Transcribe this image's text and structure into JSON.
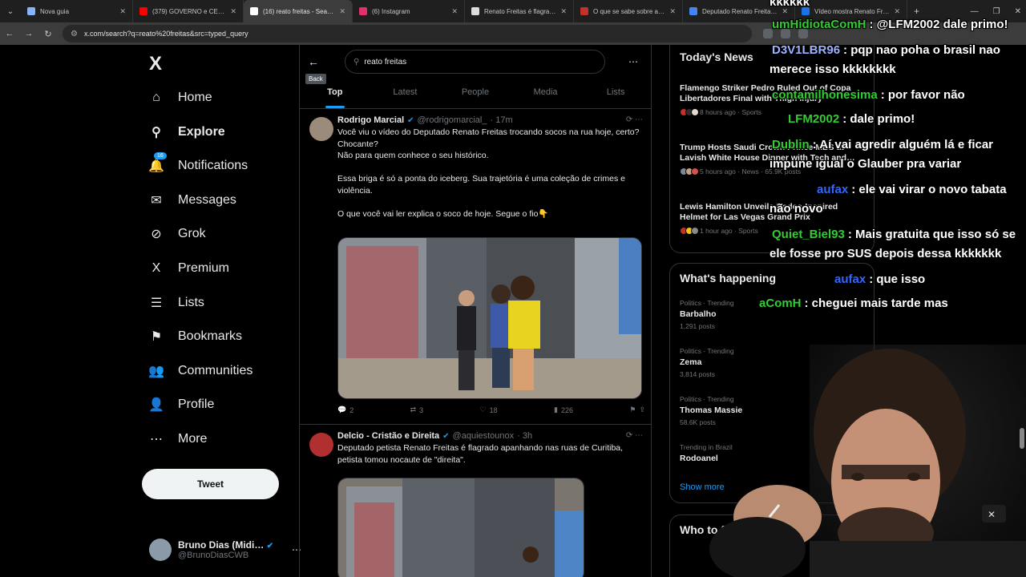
{
  "browser": {
    "tabs": [
      {
        "label": "Nova guia",
        "color": "#8ab4f8"
      },
      {
        "label": "(379) GOVERNO e CENTR…",
        "color": "#ff0000"
      },
      {
        "label": "(16) reato freitas - Search",
        "color": "#ffffff",
        "active": true
      },
      {
        "label": "(6) Instagram",
        "color": "#e1306c"
      },
      {
        "label": "Renato Freitas é flagrado…",
        "color": "#dddddd"
      },
      {
        "label": "O que se sabe sobre a bri…",
        "color": "#c4302b"
      },
      {
        "label": "Deputado Renato Freitas…",
        "color": "#4285f4"
      },
      {
        "label": "Vídeo mostra Renato Frei…",
        "color": "#1a73e8"
      }
    ],
    "new_tab": "+",
    "url": "x.com/search?q=reato%20freitas&src=typed_query"
  },
  "nav": {
    "logo": "X",
    "items": [
      {
        "label": "Home",
        "icon": "home-icon",
        "glyph": "⌂"
      },
      {
        "label": "Explore",
        "icon": "search-icon",
        "glyph": "⚲"
      },
      {
        "label": "Notifications",
        "icon": "bell-icon",
        "glyph": "🔔",
        "badge": "16"
      },
      {
        "label": "Messages",
        "icon": "mail-icon",
        "glyph": "✉"
      },
      {
        "label": "Grok",
        "icon": "grok-icon",
        "glyph": "⊘"
      },
      {
        "label": "Premium",
        "icon": "x-icon",
        "glyph": "X"
      },
      {
        "label": "Lists",
        "icon": "list-icon",
        "glyph": "☰"
      },
      {
        "label": "Bookmarks",
        "icon": "bookmark-icon",
        "glyph": "⚑"
      },
      {
        "label": "Communities",
        "icon": "people-icon",
        "glyph": "👥"
      },
      {
        "label": "Profile",
        "icon": "person-icon",
        "glyph": "👤"
      },
      {
        "label": "More",
        "icon": "more-icon",
        "glyph": "⋯"
      }
    ],
    "tweet_label": "Tweet",
    "account": {
      "name": "Bruno Dias (Midi…",
      "handle": "@BrunoDiasCWB"
    }
  },
  "search": {
    "query": "reato freitas",
    "back_tooltip": "Back",
    "tabs": [
      "Top",
      "Latest",
      "People",
      "Media",
      "Lists"
    ],
    "active_tab": "Top"
  },
  "posts": [
    {
      "name": "Rodrigo Marcial",
      "handle": "@rodrigomarcial_",
      "time": "· 17m",
      "text": "Você viu o vídeo do Deputado Renato Freitas trocando socos na rua hoje, certo? Chocante?\nNão para quem conhece o seu histórico.\n\nEssa briga é só a ponta do iceberg. Sua trajetória é uma coleção de crimes e violência.\n\nO que você vai ler explica o soco de hoje. Segue o fio👇",
      "replies": "2",
      "reposts": "3",
      "likes": "18",
      "views": "226"
    },
    {
      "name": "Delcio - Cristão e Direita",
      "handle": "@aquiestounox",
      "time": "· 3h",
      "text": "Deputado petista Renato Freitas é flagrado apanhando nas ruas de Curitiba, petista tomou nocaute de \"direita\"."
    }
  ],
  "right": {
    "news_title": "Today's News",
    "news": [
      {
        "title": "Flamengo Striker Pedro Ruled Out of Copa Libertadores Final with Thigh Injury",
        "meta": "8 hours ago · Sports"
      },
      {
        "title": "Trump Hosts Saudi Crown Prince MBS at Lavish White House Dinner with Tech and…",
        "meta": "5 hours ago · News · 65.9K posts"
      },
      {
        "title": "Lewis Hamilton Unveils Rodeo-Inspired Helmet for Las Vegas Grand Prix",
        "meta": "1 hour ago · Sports"
      }
    ],
    "happening_title": "What's happening",
    "trends": [
      {
        "cat": "Politics · Trending",
        "name": "Barbalho",
        "count": "1,291 posts"
      },
      {
        "cat": "Politics · Trending",
        "name": "Zema",
        "count": "3,814 posts"
      },
      {
        "cat": "Politics · Trending",
        "name": "Thomas Massie",
        "count": "58.6K posts"
      },
      {
        "cat": "Trending in Brazil",
        "name": "Rodoanel",
        "count": ""
      }
    ],
    "show_more": "Show more",
    "who_to_follow": "Who to f"
  },
  "chat": [
    {
      "user": "",
      "text": "kkkkkk",
      "color": "#ffffff"
    },
    {
      "user": "umHidiotaComH",
      "text": ": @LFM2002 dale primo!",
      "color": "#33cc33"
    },
    {
      "user": "D3V1LBR96",
      "text": ": pqp nao poha o brasil nao",
      "color": "#9fb4ff"
    },
    {
      "user": "",
      "text": "merece isso kkkkkkkk",
      "color": "#ffffff"
    },
    {
      "user": "contamilhonesima",
      "text": ": por favor não",
      "color": "#33cc33"
    },
    {
      "user": "LFM2002",
      "text": ": dale primo!",
      "color": "#33cc33"
    },
    {
      "user": "Dublin",
      "text": ": Aí vai agredir alguém lá e ficar",
      "color": "#33cc33"
    },
    {
      "user": "",
      "text": "impune igual o Glauber pra variar",
      "color": "#ffffff"
    },
    {
      "user": "aufax",
      "text": ": ele vai virar o novo tabata",
      "color": "#3366ff"
    },
    {
      "user": "",
      "text": "não novo",
      "color": "#ffffff"
    },
    {
      "user": "Quiet_Biel93",
      "text": ": Mais gratuita que isso só se",
      "color": "#33cc33"
    },
    {
      "user": "",
      "text": "ele fosse pro SUS depois dessa kkkkkkk",
      "color": "#ffffff"
    },
    {
      "user": "aufax",
      "text": ": que isso",
      "color": "#3366ff"
    },
    {
      "user": "aComH",
      "text": ": cheguei mais tarde mas",
      "color": "#33cc33"
    }
  ]
}
